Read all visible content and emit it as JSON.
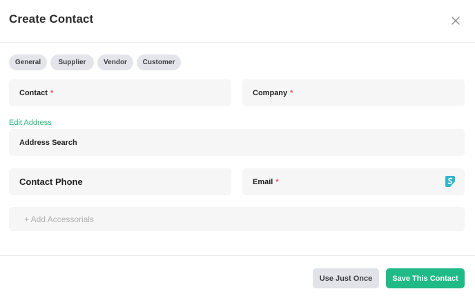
{
  "dialog": {
    "title": "Create Contact"
  },
  "tags": [
    "General",
    "Supplier",
    "Vendor",
    "Customer"
  ],
  "fields": {
    "contact": {
      "label": "Contact",
      "required_mark": "*"
    },
    "company": {
      "label": "Company",
      "required_mark": "*"
    },
    "address_search": {
      "label": "Address Search"
    },
    "contact_phone": {
      "label": "Contact Phone"
    },
    "email": {
      "label": "Email",
      "required_mark": "*"
    }
  },
  "edit_address_link": "Edit Address",
  "accessorials_label": "+ Add Accessorials",
  "buttons": {
    "use_once": "Use Just Once",
    "save": "Save This Contact"
  },
  "colors": {
    "accent_green": "#1fba86",
    "link_green": "#21b37a",
    "required_red": "#e05565",
    "tag_bg": "#e4e5ea",
    "field_bg": "#f6f6f6",
    "extension_icon": "#2fb6c9"
  },
  "icons": {
    "close": "close-icon",
    "extension": "password-extension-icon"
  }
}
